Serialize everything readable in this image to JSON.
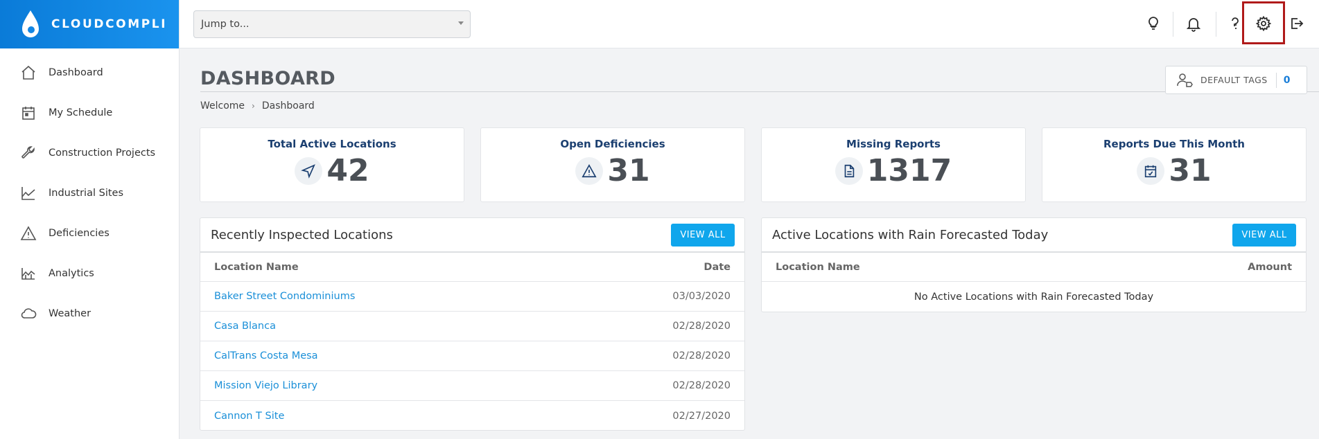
{
  "app": {
    "brand": "CLOUDCOMPLI"
  },
  "sidebar": {
    "items": [
      {
        "label": "Dashboard",
        "icon": "home-icon"
      },
      {
        "label": "My Schedule",
        "icon": "calendar-icon"
      },
      {
        "label": "Construction Projects",
        "icon": "wrench-icon"
      },
      {
        "label": "Industrial Sites",
        "icon": "factory-icon"
      },
      {
        "label": "Deficiencies",
        "icon": "warning-icon"
      },
      {
        "label": "Analytics",
        "icon": "chart-icon"
      },
      {
        "label": "Weather",
        "icon": "cloud-icon"
      }
    ]
  },
  "topbar": {
    "jump_placeholder": "Jump to...",
    "icons": [
      "lightbulb-icon",
      "bell-icon",
      "help-icon",
      "gear-icon",
      "logout-icon"
    ]
  },
  "page": {
    "title": "DASHBOARD",
    "breadcrumb": [
      "Welcome",
      "Dashboard"
    ],
    "default_tags": {
      "label": "DEFAULT TAGS",
      "count": "0"
    }
  },
  "stats": [
    {
      "title": "Total Active Locations",
      "value": "42",
      "icon": "navigation-arrow-icon"
    },
    {
      "title": "Open Deficiencies",
      "value": "31",
      "icon": "warning-icon"
    },
    {
      "title": "Missing Reports",
      "value": "1317",
      "icon": "document-icon"
    },
    {
      "title": "Reports Due This Month",
      "value": "31",
      "icon": "calendar-check-icon"
    }
  ],
  "recent": {
    "title": "Recently Inspected Locations",
    "view_all": "VIEW ALL",
    "columns": [
      "Location Name",
      "Date"
    ],
    "rows": [
      {
        "name": "Baker Street Condominiums",
        "date": "03/03/2020"
      },
      {
        "name": "Casa Blanca",
        "date": "02/28/2020"
      },
      {
        "name": "CalTrans Costa Mesa",
        "date": "02/28/2020"
      },
      {
        "name": "Mission Viejo Library",
        "date": "02/28/2020"
      },
      {
        "name": "Cannon T Site",
        "date": "02/27/2020"
      }
    ]
  },
  "rain": {
    "title": "Active Locations with Rain Forecasted Today",
    "view_all": "VIEW ALL",
    "columns": [
      "Location Name",
      "Amount"
    ],
    "empty": "No Active Locations with Rain Forecasted Today"
  },
  "colors": {
    "brand": "#0a7bd8",
    "accent": "#10a6ec",
    "link": "#1a8fd8",
    "highlight": "#b01a1a"
  }
}
